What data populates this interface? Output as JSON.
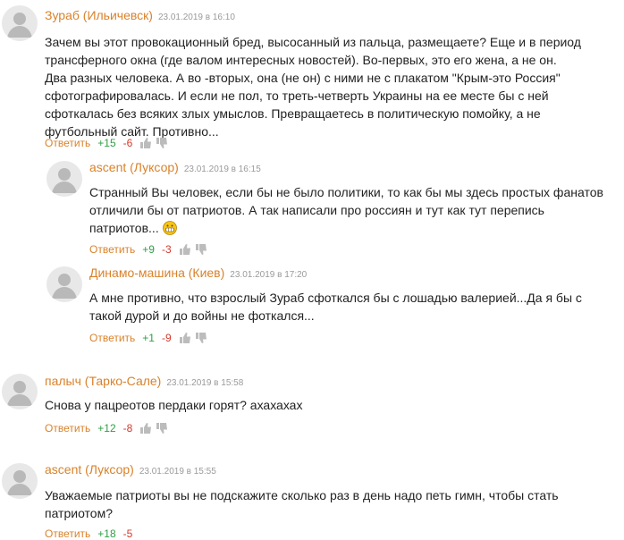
{
  "comments": [
    {
      "author": "Зураб (Ильичевск)",
      "date": "23.01.2019 в 16:10",
      "text": "Зачем вы этот провокационный бред, высосанный из пальца, размещаете? Еще и в период трансферного окна (где валом интересных новостей). Во-первых, это его жена, а не он. Два разных человека. А во -вторых, она (не он) с ними не с плакатом \"Крым-это Россия\" сфотографировалась. И если не пол, то треть-четверть Украины на ее месте бы с ней сфоткалась без всяких злых умыслов. Превращаетесь в политическую помойку, а не футбольный сайт. Противно...",
      "reply": "Ответить",
      "plus": "+15",
      "minus": "-6"
    },
    {
      "author": "ascent (Луксор)",
      "date": "23.01.2019 в 16:15",
      "text": "Странный Вы человек, если бы не было политики, то как бы мы здесь простых фанатов отличили бы от патриотов. А так написали про россиян и тут как тут перепись патриотов...",
      "reply": "Ответить",
      "plus": "+9",
      "minus": "-3"
    },
    {
      "author": "Динамо-машина (Киев)",
      "date": "23.01.2019 в 17:20",
      "text": "А мне противно, что взрослый Зураб сфоткался бы с лошадью валерией...Да я бы с такой дурой и до войны не фоткался...",
      "reply": "Ответить",
      "plus": "+1",
      "minus": "-9"
    },
    {
      "author": "палыч (Тарко-Сале)",
      "date": "23.01.2019 в 15:58",
      "text": "Снова у пацреотов пердаки горят? ахахахах",
      "reply": "Ответить",
      "plus": "+12",
      "minus": "-8"
    },
    {
      "author": "ascent (Луксор)",
      "date": "23.01.2019 в 15:55",
      "text": "Уважаемые патриоты вы не подскажите сколько раз в день надо петь гимн, чтобы стать патриотом?",
      "reply": "Ответить",
      "plus": "+18",
      "minus": "-5"
    }
  ],
  "icons": {
    "avatar": "default-user-avatar",
    "like": "thumb-up-icon",
    "dislike": "thumb-down-icon",
    "emoji": "grin-emoji-icon"
  },
  "colors": {
    "author": "#d9822b",
    "date": "#9a9a9a",
    "plus": "#2ea043",
    "minus": "#d33a2c"
  }
}
